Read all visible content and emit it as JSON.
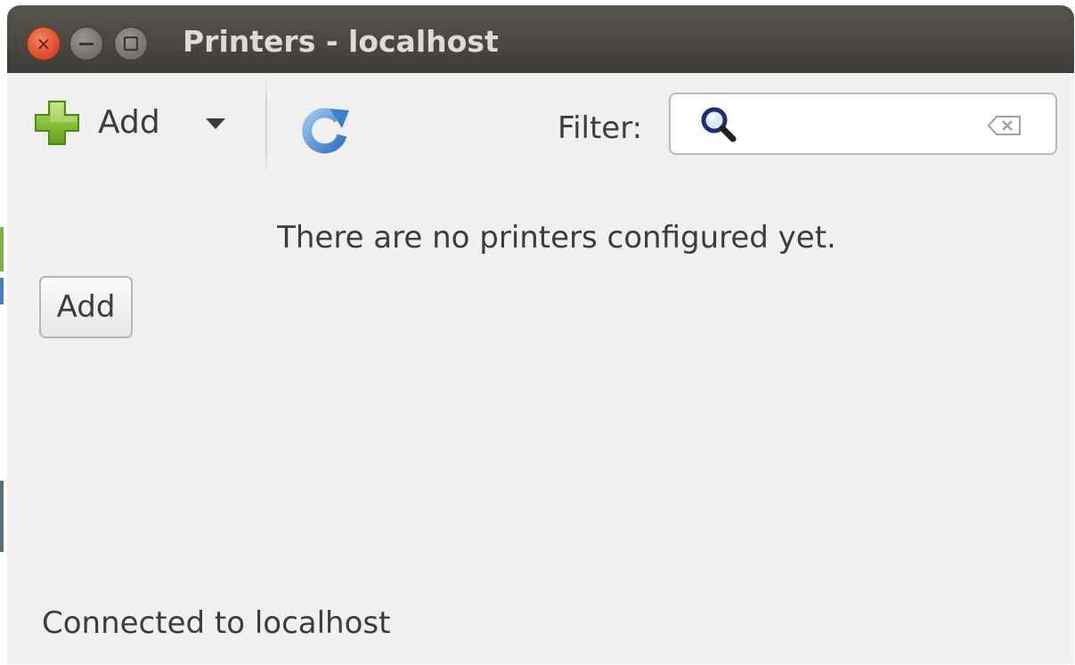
{
  "window": {
    "title": "Printers - localhost",
    "close_glyph": "×",
    "controls": {
      "close_icon": "close-icon",
      "minimize_icon": "minimize-icon",
      "maximize_icon": "maximize-icon"
    }
  },
  "toolbar": {
    "add_label": "Add",
    "add_icon": "green-plus-icon",
    "dropdown_icon": "chevron-down-icon",
    "refresh_icon": "refresh-icon",
    "filter_label": "Filter:",
    "filter_value": "",
    "search_icon": "magnifier-icon",
    "clear_icon": "clear-input-icon"
  },
  "main": {
    "empty_message": "There are no printers configured yet.",
    "add_button_label": "Add"
  },
  "status": {
    "text": "Connected to localhost"
  },
  "colors": {
    "titlebar": "#4a4844",
    "title_text": "#dfdbd2",
    "close_button": "#e0502a",
    "window_bg": "#f0f0f0",
    "plus_green": "#7bbf2c",
    "refresh_blue": "#4a90d9"
  }
}
